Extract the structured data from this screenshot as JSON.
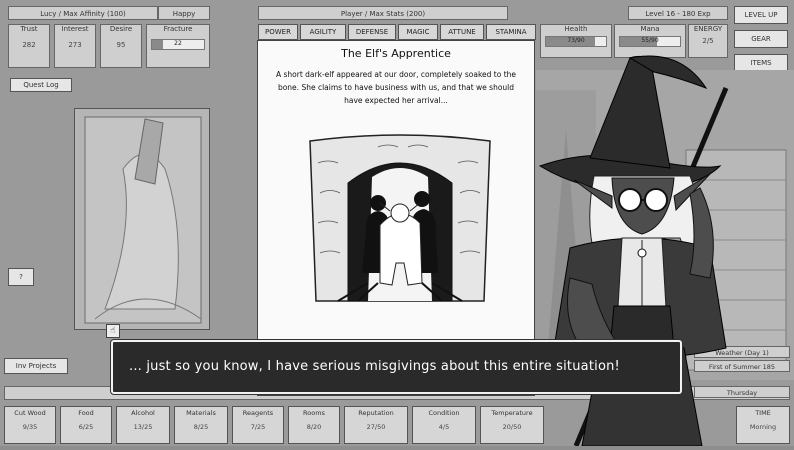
{
  "top_bar": {
    "lucy_header": "Lucy / Max Affinity (100)",
    "lucy_mood": "Happy",
    "player_header": "Player / Max Stats (200)",
    "level": "Level 16 - 180 Exp"
  },
  "lucy_stats": [
    {
      "label": "Trust",
      "value": "282"
    },
    {
      "label": "Interest",
      "value": "273"
    },
    {
      "label": "Desire",
      "value": "95"
    },
    {
      "label": "Fracture",
      "value": "22",
      "fill": 0.22
    }
  ],
  "quest_log": "Quest Log",
  "side_small": "?",
  "player_stats": [
    {
      "label": "POWER"
    },
    {
      "label": "AGILITY"
    },
    {
      "label": "DEFENSE"
    },
    {
      "label": "MAGIC"
    },
    {
      "label": "ATTUNE"
    },
    {
      "label": "STAMINA"
    }
  ],
  "vitals": [
    {
      "label": "Health",
      "value": "73/90"
    },
    {
      "label": "Mana",
      "value": "55/90"
    },
    {
      "label": "ENERGY",
      "value": "2/5"
    }
  ],
  "right_buttons": [
    "LEVEL UP",
    "GEAR",
    "ITEMS"
  ],
  "bottom_left_button": "Inv Projects",
  "weather": {
    "label": "Weather (Day 1)",
    "season": "First of Summer 185"
  },
  "day": "Thursday",
  "resources": [
    {
      "label": "Cut Wood",
      "value": "9/35"
    },
    {
      "label": "Food",
      "value": "6/25"
    },
    {
      "label": "Alcohol",
      "value": "13/25"
    },
    {
      "label": "Materials",
      "value": "8/25"
    },
    {
      "label": "Reagents",
      "value": "7/25"
    },
    {
      "label": "Rooms",
      "value": "8/20"
    },
    {
      "label": "Reputation",
      "value": "27/50"
    },
    {
      "label": "Condition",
      "value": "4/5"
    },
    {
      "label": "Temperature",
      "value": "20/50"
    },
    {
      "label": "TIME",
      "value": "Morning"
    }
  ],
  "event_card": {
    "title": "The Elf's Apprentice",
    "text": "A short dark-elf appeared at our door, completely soaked to the bone. She claims to have business with us, and that we should have expected her arrival..."
  },
  "dialog": {
    "text": "... just so you know, I have serious misgivings about this entire situation!"
  }
}
